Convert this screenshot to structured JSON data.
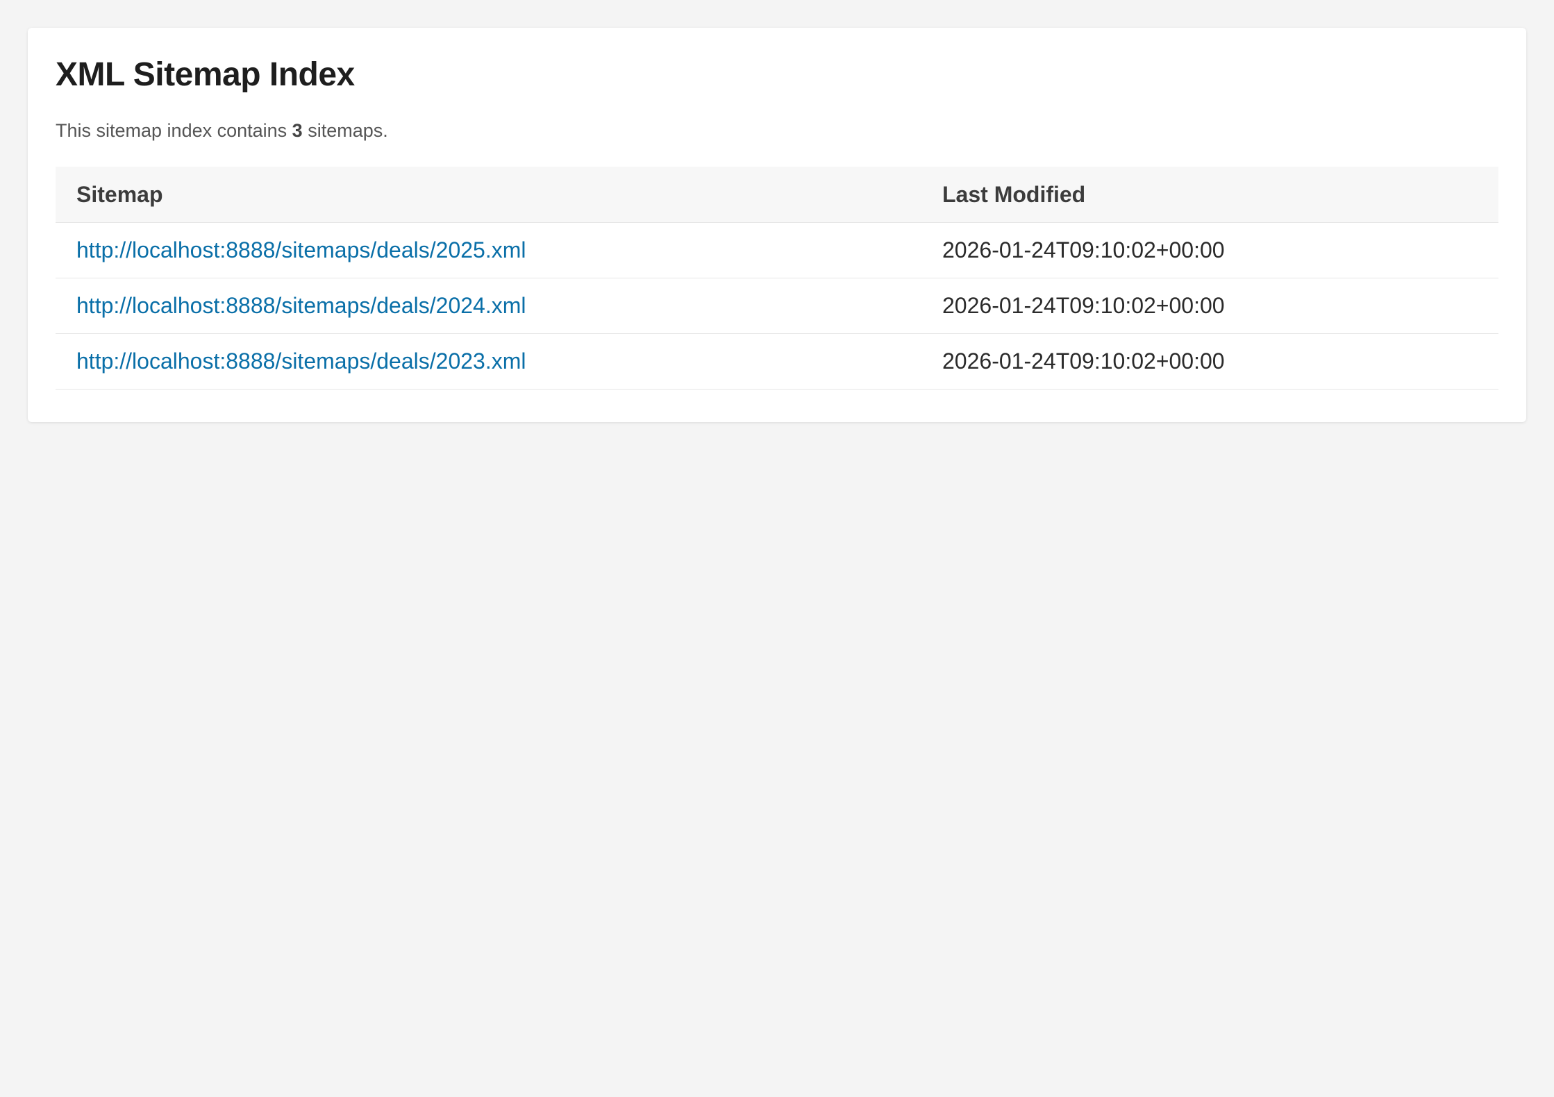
{
  "page": {
    "title": "XML Sitemap Index",
    "summary_prefix": "This sitemap index contains ",
    "summary_count": "3",
    "summary_suffix": " sitemaps."
  },
  "table": {
    "headers": [
      "Sitemap",
      "Last Modified"
    ],
    "rows": [
      {
        "url": "http://localhost:8888/sitemaps/deals/2025.xml",
        "last_modified": "2026-01-24T09:10:02+00:00"
      },
      {
        "url": "http://localhost:8888/sitemaps/deals/2024.xml",
        "last_modified": "2026-01-24T09:10:02+00:00"
      },
      {
        "url": "http://localhost:8888/sitemaps/deals/2023.xml",
        "last_modified": "2026-01-24T09:10:02+00:00"
      }
    ]
  },
  "colors": {
    "link": "#0a6fa8",
    "background": "#f4f4f4",
    "card": "#ffffff",
    "header_row": "#f7f7f7"
  }
}
